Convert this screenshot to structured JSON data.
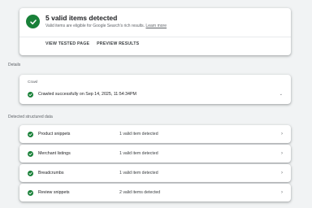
{
  "summary": {
    "title": "5 valid items detected",
    "subtitle": "Valid items are eligible for Google Search's rich results.",
    "learn_more": "Learn more",
    "actions": [
      "VIEW TESTED PAGE",
      "PREVIEW RESULTS"
    ]
  },
  "sections": {
    "details_label": "Details",
    "structured_label": "Detected structured data"
  },
  "crawl": {
    "label": "Crawl",
    "status": "Crawled successfully on Sep 14, 2025, 11:54:34PM"
  },
  "items": [
    {
      "name": "Product snippets",
      "status": "1 valid item detected"
    },
    {
      "name": "Merchant listings",
      "status": "1 valid item detected"
    },
    {
      "name": "Breadcrumbs",
      "status": "1 valid item detected"
    },
    {
      "name": "Review snippets",
      "status": "2 valid items detected"
    }
  ],
  "colors": {
    "success_green": "#188038",
    "background": "#f1f3f4",
    "card": "#ffffff"
  }
}
